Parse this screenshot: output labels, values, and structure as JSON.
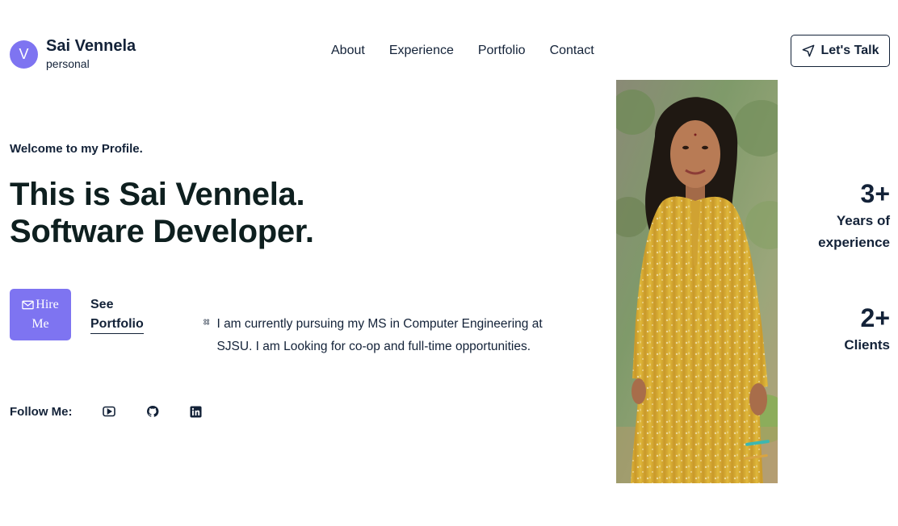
{
  "header": {
    "logo_initial": "V",
    "logo_name": "Sai Vennela",
    "logo_sub": "personal",
    "nav": [
      "About",
      "Experience",
      "Portfolio",
      "Contact"
    ],
    "cta": "Let's Talk"
  },
  "hero": {
    "welcome": "Welcome to my Profile.",
    "headline_1": "This is Sai Vennela.",
    "headline_2": "Software Developer.",
    "hire_line1": "Hire",
    "hire_line2": "Me",
    "see_line1": "See",
    "see_line2": "Portfolio",
    "description": "I am currently pursuing my MS in Computer Engineering at SJSU. I am Looking for co-op and full-time opportunities.",
    "follow_label": "Follow Me:",
    "socials": [
      "youtube-icon",
      "github-icon",
      "linkedin-icon"
    ]
  },
  "stats": [
    {
      "value": "3+",
      "label_1": "Years of",
      "label_2": "experience"
    },
    {
      "value": "2+",
      "label_1": "Clients",
      "label_2": ""
    }
  ],
  "colors": {
    "accent": "#7e74f1",
    "text": "#132238",
    "photo_dress": "#d9ae2f"
  }
}
